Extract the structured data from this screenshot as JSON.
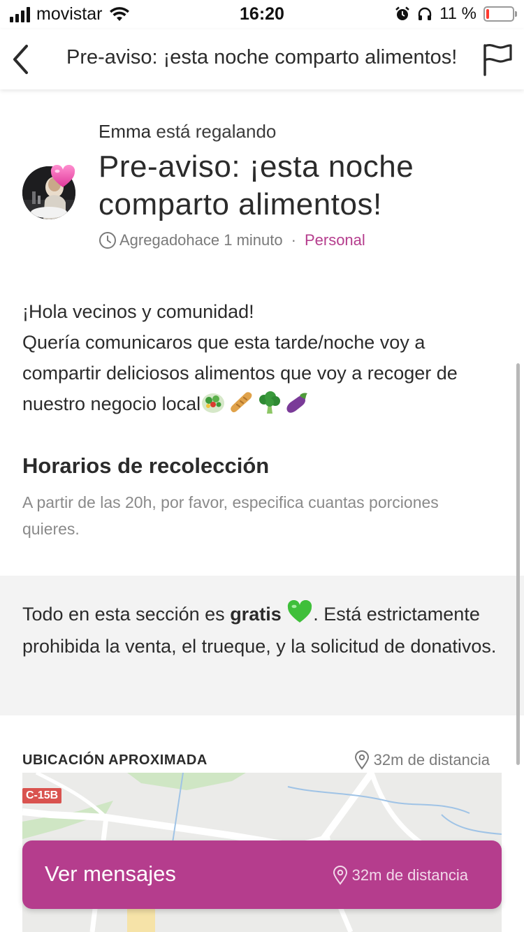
{
  "status_bar": {
    "carrier": "movistar",
    "time": "16:20",
    "battery_text": "11 %",
    "battery_level": 0.11,
    "icons": [
      "signal-icon",
      "wifi-icon",
      "alarm-icon",
      "headphones-icon",
      "battery-icon"
    ]
  },
  "header": {
    "title": "Pre-aviso: ¡esta noche comparto alimentos!",
    "back_icon": "chevron-left-icon",
    "report_icon": "flag-icon"
  },
  "post": {
    "author_name": "Emma",
    "author_action": "está regalando",
    "title": "Pre-aviso: ¡esta noche comparto alimentos!",
    "added_label": "Agregado",
    "added_time": "hace 1 minuto",
    "separator": "·",
    "category": "Personal",
    "description_lines": [
      "¡Hola vecinos y comunidad!",
      "Quería comunicaros que esta tarde/noche voy a compartir deliciosos alimentos que voy a recoger de nuestro negocio local"
    ],
    "emojis": [
      "salad-icon",
      "baguette-icon",
      "broccoli-icon",
      "eggplant-icon"
    ],
    "pickup_title": "Horarios de recolección",
    "pickup_text": "A partir de las 20h, por favor, especifica cuantas porciones quieres."
  },
  "notice": {
    "prefix": "Todo en esta sección es ",
    "bold": "gratis",
    "suffix": ". Está estrictamente prohibida la venta, el trueque, y la solicitud de donativos."
  },
  "location": {
    "label": "UBICACIÓN APROXIMADA",
    "distance": "32m de distancia",
    "map_road_label": "C-15B"
  },
  "actions": {
    "messages_button": "Ver mensajes",
    "messages_distance": "32m de distancia"
  },
  "colors": {
    "accent": "#b53d8d",
    "notice_bg": "#f3f3f3",
    "battery_low": "#ff3b30"
  }
}
